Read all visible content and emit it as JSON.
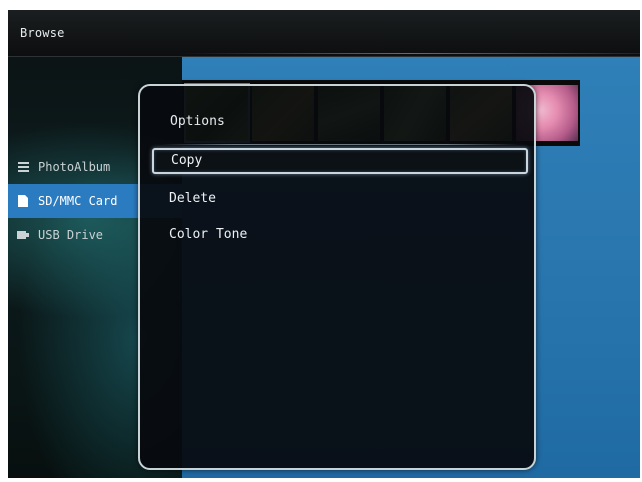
{
  "window": {
    "title": "Browse"
  },
  "sidebar": {
    "items": [
      {
        "label": "PhotoAlbum",
        "icon": "list-icon",
        "selected": false
      },
      {
        "label": "SD/MMC Card",
        "icon": "memory-card-icon",
        "selected": true
      },
      {
        "label": "USB Drive",
        "icon": "usb-drive-icon",
        "selected": false
      }
    ]
  },
  "options_menu": {
    "title": "Options",
    "items": [
      {
        "label": "Copy",
        "focused": true
      },
      {
        "label": "Delete",
        "focused": false
      },
      {
        "label": "Color Tone",
        "focused": false
      }
    ]
  },
  "colors": {
    "selection_blue": "#2b7bc0",
    "content_blue": "#2f7fb8",
    "dialog_border": "#c8d3d8"
  }
}
